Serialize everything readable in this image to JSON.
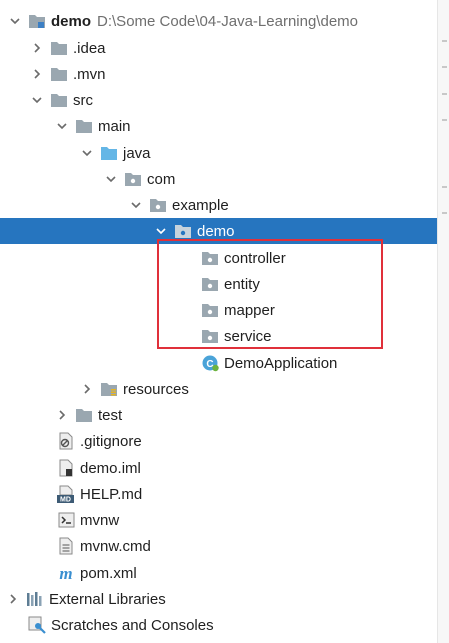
{
  "tree": {
    "project": {
      "name": "demo",
      "path": "D:\\Some Code\\04-Java-Learning\\demo"
    },
    "items": [
      {
        "label": ".idea"
      },
      {
        "label": ".mvn"
      },
      {
        "label": "src"
      },
      {
        "label": "main"
      },
      {
        "label": "java"
      },
      {
        "label": "com"
      },
      {
        "label": "example"
      },
      {
        "label": "demo"
      },
      {
        "label": "controller"
      },
      {
        "label": "entity"
      },
      {
        "label": "mapper"
      },
      {
        "label": "service"
      },
      {
        "label": "DemoApplication"
      },
      {
        "label": "resources"
      },
      {
        "label": "test"
      },
      {
        "label": ".gitignore"
      },
      {
        "label": "demo.iml"
      },
      {
        "label": "HELP.md"
      },
      {
        "label": "mvnw"
      },
      {
        "label": "mvnw.cmd"
      },
      {
        "label": "pom.xml"
      },
      {
        "label": "External Libraries"
      },
      {
        "label": "Scratches and Consoles"
      }
    ]
  },
  "colors": {
    "selection": "#2675bf",
    "highlight_border": "#e0303a",
    "folder": "#9aa7b0",
    "source_folder": "#64b6e6"
  }
}
